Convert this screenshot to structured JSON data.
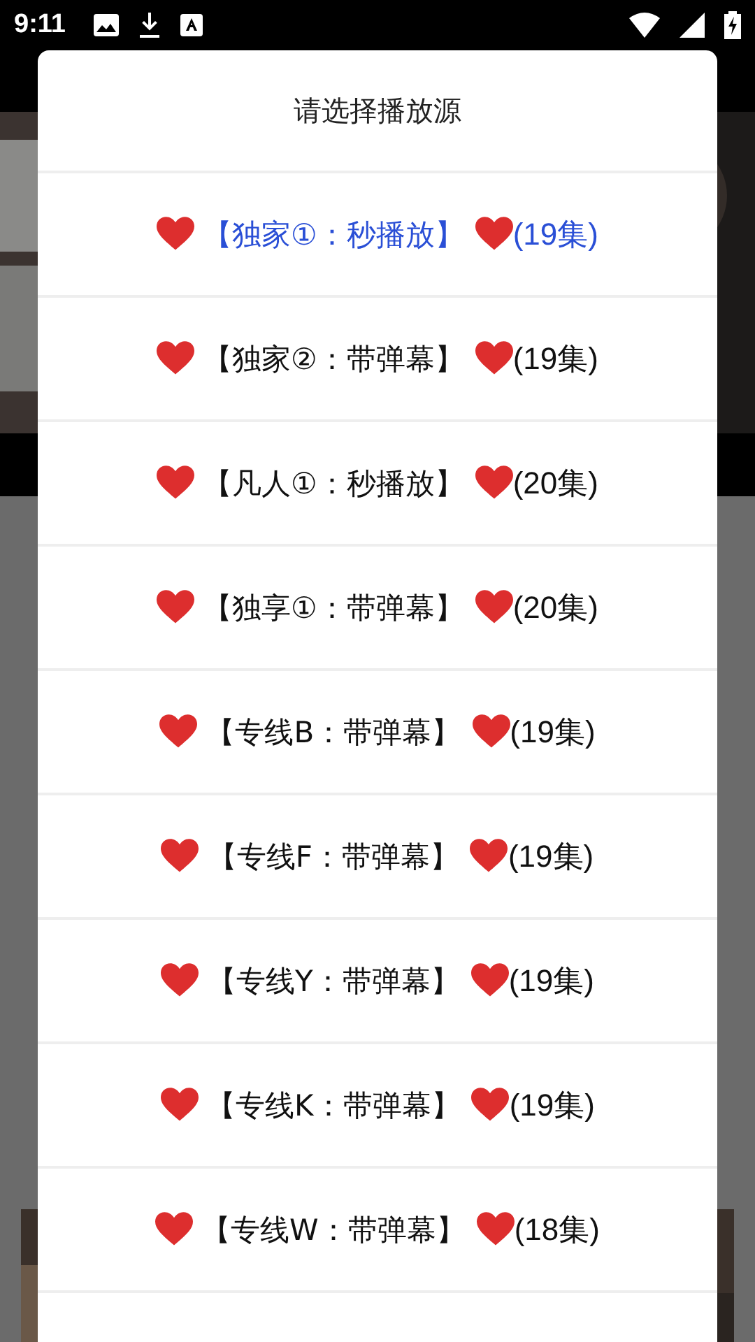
{
  "status_bar": {
    "time": "9:11"
  },
  "dialog": {
    "title": "请选择播放源",
    "items": [
      {
        "label": "【独家①：秒播放】",
        "count": "(19集)",
        "selected": true
      },
      {
        "label": "【独家②：带弹幕】",
        "count": "(19集)",
        "selected": false
      },
      {
        "label": "【凡人①：秒播放】",
        "count": "(20集)",
        "selected": false
      },
      {
        "label": "【独享①：带弹幕】",
        "count": "(20集)",
        "selected": false
      },
      {
        "label": "【专线B：带弹幕】",
        "count": "(19集)",
        "selected": false
      },
      {
        "label": "【专线F：带弹幕】",
        "count": "(19集)",
        "selected": false
      },
      {
        "label": "【专线Y：带弹幕】",
        "count": "(19集)",
        "selected": false
      },
      {
        "label": "【专线K：带弹幕】",
        "count": "(19集)",
        "selected": false
      },
      {
        "label": "【专线W：带弹幕】",
        "count": "(18集)",
        "selected": false
      }
    ]
  }
}
